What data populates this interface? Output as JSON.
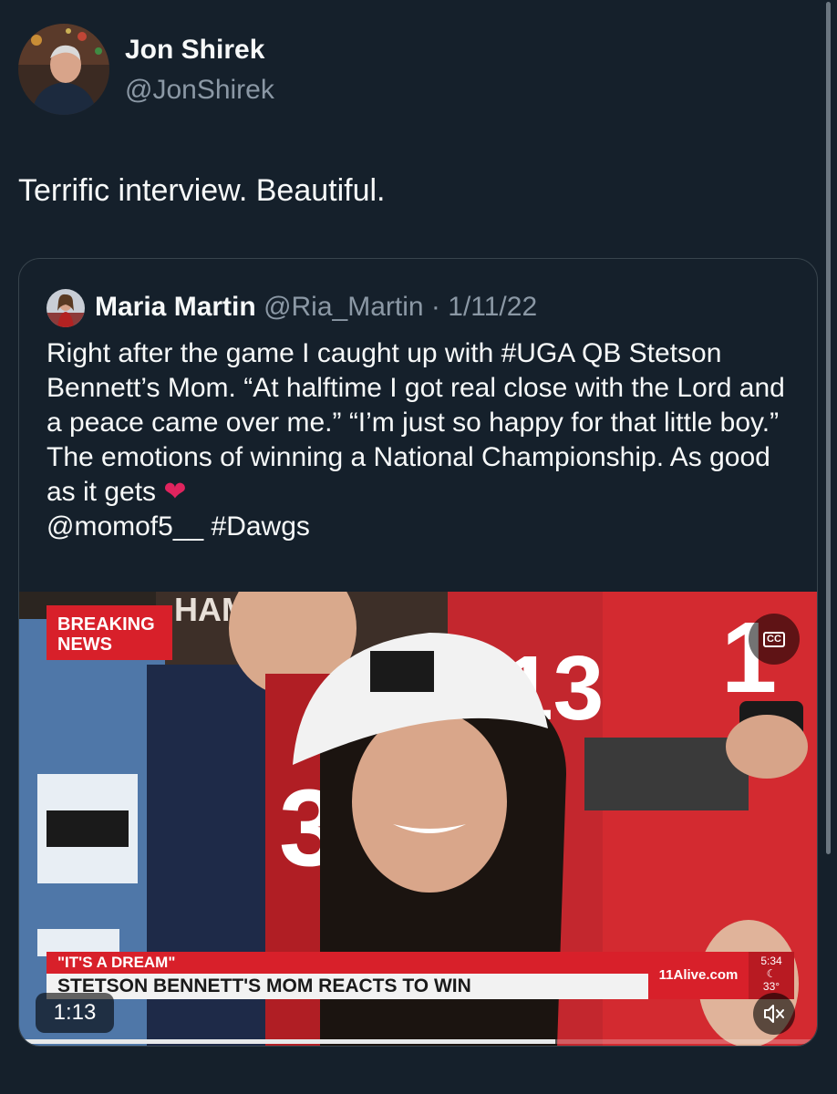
{
  "tweet": {
    "author_name": "Jon Shirek",
    "author_handle": "@JonShirek",
    "text": "Terrific interview. Beautiful."
  },
  "quoted_tweet": {
    "author_name": "Maria Martin",
    "author_handle": "@Ria_Martin",
    "separator": "·",
    "date": "1/11/22",
    "text": "Right after the game I caught up with #UGA QB Stetson Bennett’s Mom. “At halftime I got real close with the Lord and a peace came over me.” “I’m just so happy for that little boy.” The emotions of winning a National Championship. As good as it gets",
    "emoji_name": "red-heart",
    "text_tail": "@momof5__ #Dawgs"
  },
  "video": {
    "breaking_line1": "BREAKING",
    "breaking_line2": "NEWS",
    "cc_label": "CC",
    "lower_third_top": "\"IT'S A DREAM\"",
    "lower_third_bottom": "STETSON BENNETT'S MOM REACTS TO WIN",
    "station": "11Alive.com",
    "time": "5:34",
    "temperature": "33°",
    "duration": "1:13",
    "progress_fraction": 0.67,
    "mute_icon": "speaker-muted-icon"
  },
  "colors": {
    "background": "#15202b",
    "text_primary": "#f7f9f9",
    "text_secondary": "#8b98a5",
    "border": "#38444d",
    "news_red": "#d8202a"
  }
}
